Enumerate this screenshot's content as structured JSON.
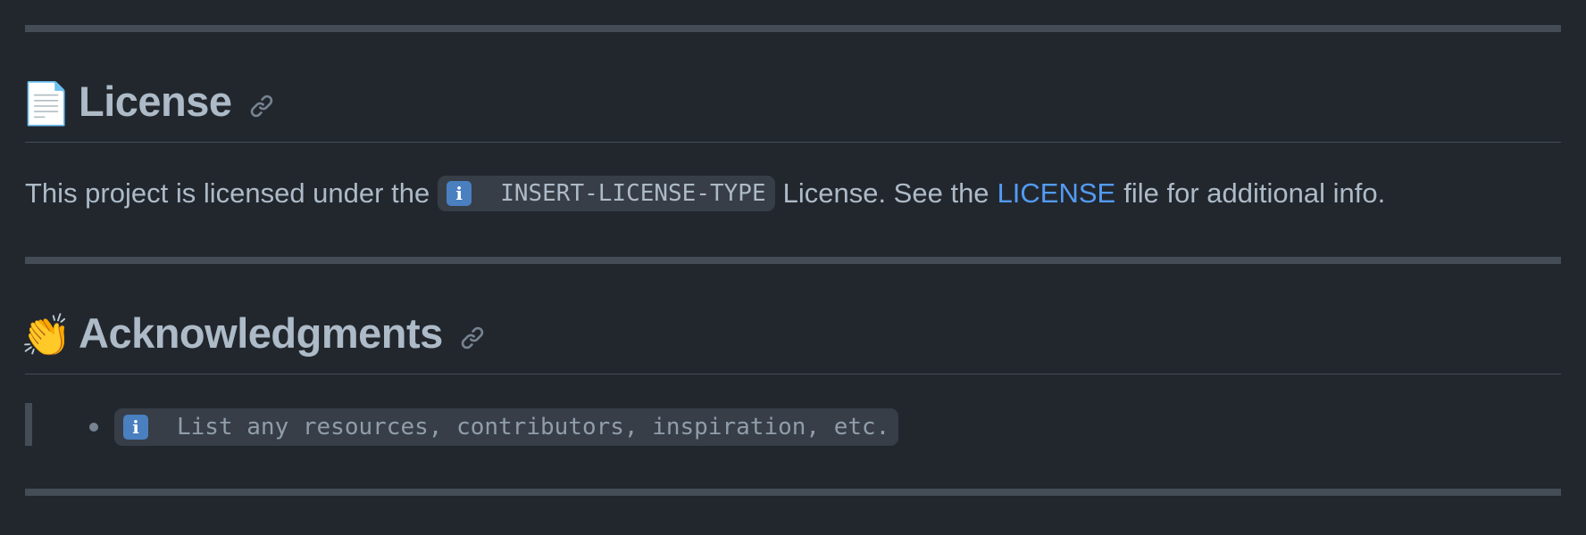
{
  "license_section": {
    "emoji": "📄",
    "title": "License",
    "anchor_icon": "link-icon",
    "text_before": "This project is licensed under the",
    "code_icon": "i",
    "code_text": "INSERT-LICENSE-TYPE",
    "text_middle": "License. See the",
    "link_text": "LICENSE",
    "text_after": "file for additional info."
  },
  "acknowledgments_section": {
    "emoji": "👏",
    "title": "Acknowledgments",
    "anchor_icon": "link-icon",
    "items": [
      {
        "code_icon": "i",
        "code_text": "List any resources, contributors, inspiration, etc."
      }
    ]
  },
  "colors": {
    "background": "#22272e",
    "text": "#adbac7",
    "link": "#539bf5",
    "rule": "#444c56",
    "code_bg": "#373e47",
    "info_icon_bg": "#4a7fc0"
  }
}
